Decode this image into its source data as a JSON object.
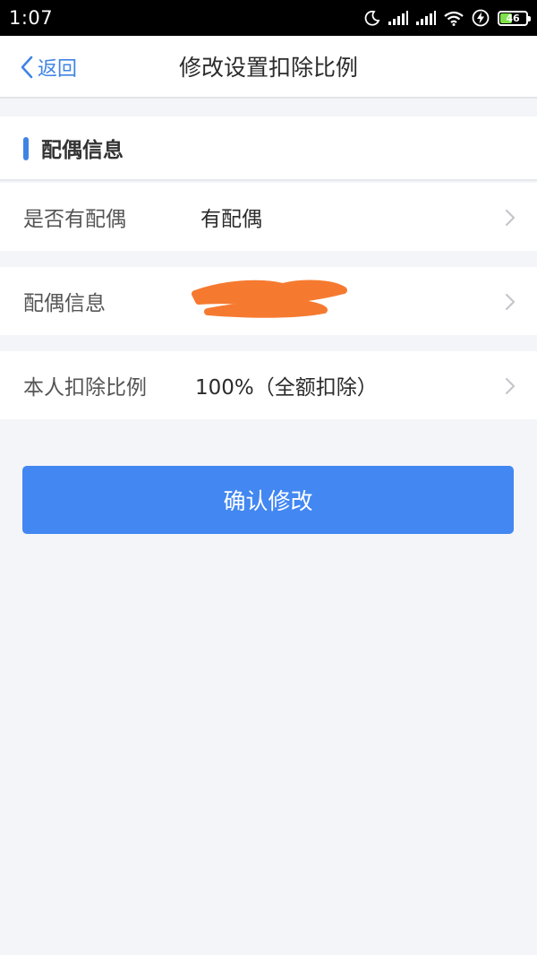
{
  "status_bar": {
    "time": "1:07",
    "battery": "46",
    "battery_fraction": 0.46,
    "icons": [
      "moon-icon",
      "signal-icon",
      "signal-icon",
      "wifi-icon",
      "charging-icon",
      "battery-icon"
    ]
  },
  "nav": {
    "back_label": "返回",
    "title": "修改设置扣除比例"
  },
  "section": {
    "title": "配偶信息"
  },
  "rows": [
    {
      "label": "是否有配偶",
      "value": "有配偶"
    },
    {
      "label": "配偶信息",
      "value": ""
    },
    {
      "label": "本人扣除比例",
      "value": "100%（全额扣除）"
    }
  ],
  "confirm_label": "确认修改",
  "colors": {
    "accent": "#3f84e4",
    "button": "#4287f2",
    "background": "#f4f5f9",
    "redaction": "#f57a30"
  }
}
